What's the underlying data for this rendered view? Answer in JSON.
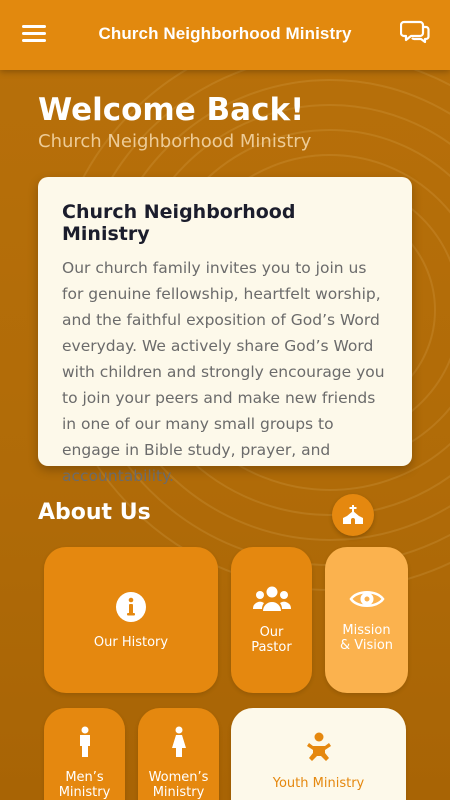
{
  "header": {
    "title": "Church Neighborhood Ministry",
    "menu_icon": "hamburger-menu-icon",
    "chat_icon": "chat-bubbles-icon"
  },
  "welcome": {
    "heading": "Welcome Back!",
    "subtitle": "Church Neighborhood Ministry"
  },
  "intro_card": {
    "title": "Church Neighborhood Ministry",
    "body": "Our church family invites you to join us for genuine fellowship, heartfelt worship, and the faithful exposition of God’s Word everyday. We actively share God’s Word with children and strongly encourage you to join your peers and make new friends in one of our many small groups to engage in Bible study, prayer, and accountability."
  },
  "about": {
    "title": "About Us",
    "church_icon": "church-icon",
    "tiles": [
      {
        "label": "Our History",
        "icon": "info-circle-icon"
      },
      {
        "label": "Our Pastor",
        "icon": "users-group-icon"
      },
      {
        "label": "Mission & Vision",
        "icon": "eye-icon"
      },
      {
        "label": "Men’s Ministry",
        "icon": "male-icon"
      },
      {
        "label": "Women’s Ministry",
        "icon": "female-icon"
      },
      {
        "label": "Youth Ministry",
        "icon": "child-icon"
      }
    ]
  },
  "colors": {
    "accent": "#e2890e",
    "background": "#b06b08",
    "card": "#fdf9ea",
    "tile": "#e5880f",
    "tile_light": "#fbb24e"
  }
}
